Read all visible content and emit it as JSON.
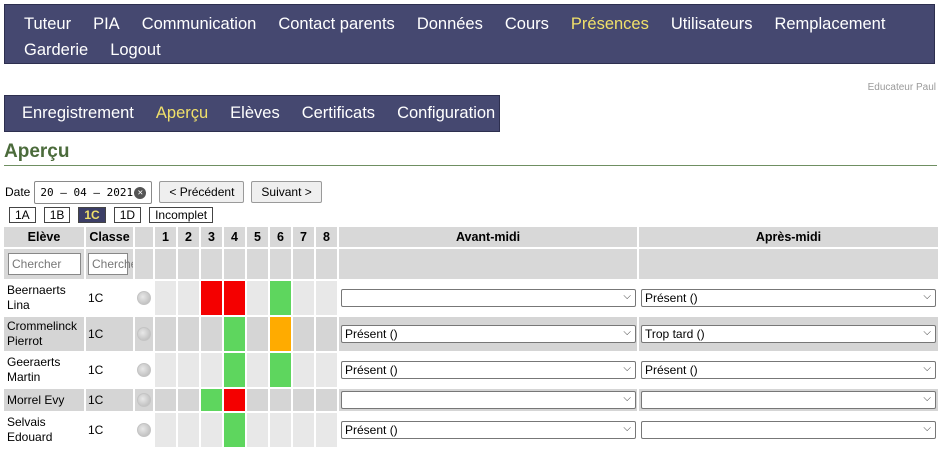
{
  "topnav": {
    "row1": [
      "Tuteur",
      "PIA",
      "Communication",
      "Contact parents",
      "Données",
      "Cours",
      "Présences",
      "Utilisateurs",
      "Remplacement"
    ],
    "row2": [
      "Garderie",
      "Logout"
    ],
    "active": "Présences"
  },
  "user_label": "Educateur Paul",
  "subnav": {
    "items": [
      "Enregistrement",
      "Aperçu",
      "Elèves",
      "Certificats",
      "Configuration"
    ],
    "active": "Aperçu"
  },
  "page_title": "Aperçu",
  "date": {
    "label": "Date",
    "value": "20 – 04 – 2021",
    "prev_label": "< Précédent",
    "next_label": "Suivant >"
  },
  "classes": {
    "items": [
      "1A",
      "1B",
      "1C",
      "1D",
      "Incomplet"
    ],
    "active": "1C"
  },
  "table": {
    "headers": {
      "student": "Elève",
      "class": "Classe",
      "periods": [
        "1",
        "2",
        "3",
        "4",
        "5",
        "6",
        "7",
        "8"
      ],
      "am": "Avant-midi",
      "pm": "Après-midi"
    },
    "filter_placeholder_student": "Chercher",
    "filter_placeholder_class": "Chercher",
    "rows": [
      {
        "name": "Beernaerts Lina",
        "class": "1C",
        "periods": [
          "",
          "",
          "red",
          "red",
          "",
          "green",
          "",
          ""
        ],
        "am": "",
        "pm": "Présent ()"
      },
      {
        "name": "Crommelinck Pierrot",
        "class": "1C",
        "periods": [
          "",
          "",
          "",
          "green",
          "",
          "orange",
          "",
          ""
        ],
        "am": "Présent ()",
        "pm": "Trop tard ()"
      },
      {
        "name": "Geeraerts Martin",
        "class": "1C",
        "periods": [
          "",
          "",
          "",
          "green",
          "",
          "green",
          "",
          ""
        ],
        "am": "Présent ()",
        "pm": "Présent ()"
      },
      {
        "name": "Morrel Evy",
        "class": "1C",
        "periods": [
          "",
          "",
          "green",
          "red",
          "",
          "",
          "",
          ""
        ],
        "am": "",
        "pm": ""
      },
      {
        "name": "Selvais Edouard",
        "class": "1C",
        "periods": [
          "",
          "",
          "",
          "green",
          "",
          "",
          "",
          ""
        ],
        "am": "Présent ()",
        "pm": ""
      }
    ]
  },
  "colors": {
    "nav_bg": "#454870",
    "active_text": "#f0e06a",
    "title": "#4b6b3b",
    "red": "#f40000",
    "green": "#5ed65e",
    "orange": "#ffab00"
  }
}
